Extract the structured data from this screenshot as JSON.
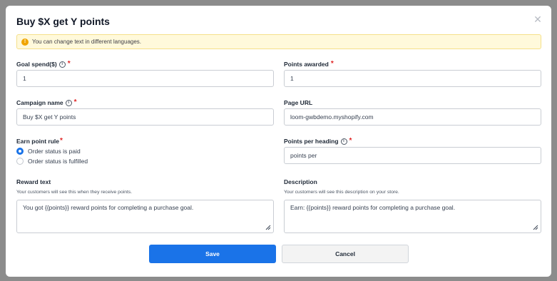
{
  "modal": {
    "title": "Buy $X get Y points",
    "close_icon": "close-icon",
    "notice": {
      "icon": "warning-icon",
      "text": "You can change text in different languages."
    }
  },
  "fields": {
    "goal_spend": {
      "label": "Goal spend($)",
      "required": "*",
      "info_icon": "info-icon",
      "value": "1"
    },
    "points_awarded": {
      "label": "Points awarded",
      "required": "*",
      "value": "1"
    },
    "campaign_name": {
      "label": "Campaign name",
      "required": "*",
      "info_icon": "info-icon",
      "value": "Buy $X get Y points"
    },
    "page_url": {
      "label": "Page URL",
      "value": "loom-gwbdemo.myshopify.com"
    },
    "earn_point_rule": {
      "label": "Earn point rule",
      "required": "*",
      "options": [
        {
          "label": "Order status is paid",
          "selected": true
        },
        {
          "label": "Order status is fulfilled",
          "selected": false
        }
      ]
    },
    "points_per_heading": {
      "label": "Points per heading",
      "required": "*",
      "info_icon": "info-icon",
      "value": "points per"
    },
    "reward_text": {
      "label": "Reward text",
      "help": "Your customers will see this when they receive points.",
      "value": "You got {{points}} reward points for completing a purchase goal."
    },
    "description": {
      "label": "Description",
      "help": "Your customers will see this description on your store.",
      "value": "Earn: {{points}} reward points for completing a purchase goal."
    }
  },
  "actions": {
    "save_label": "Save",
    "cancel_label": "Cancel"
  },
  "colors": {
    "primary": "#1a73e8",
    "required": "#e02424",
    "notice_bg": "#fff9db",
    "overlay": "#8c8c8c"
  }
}
